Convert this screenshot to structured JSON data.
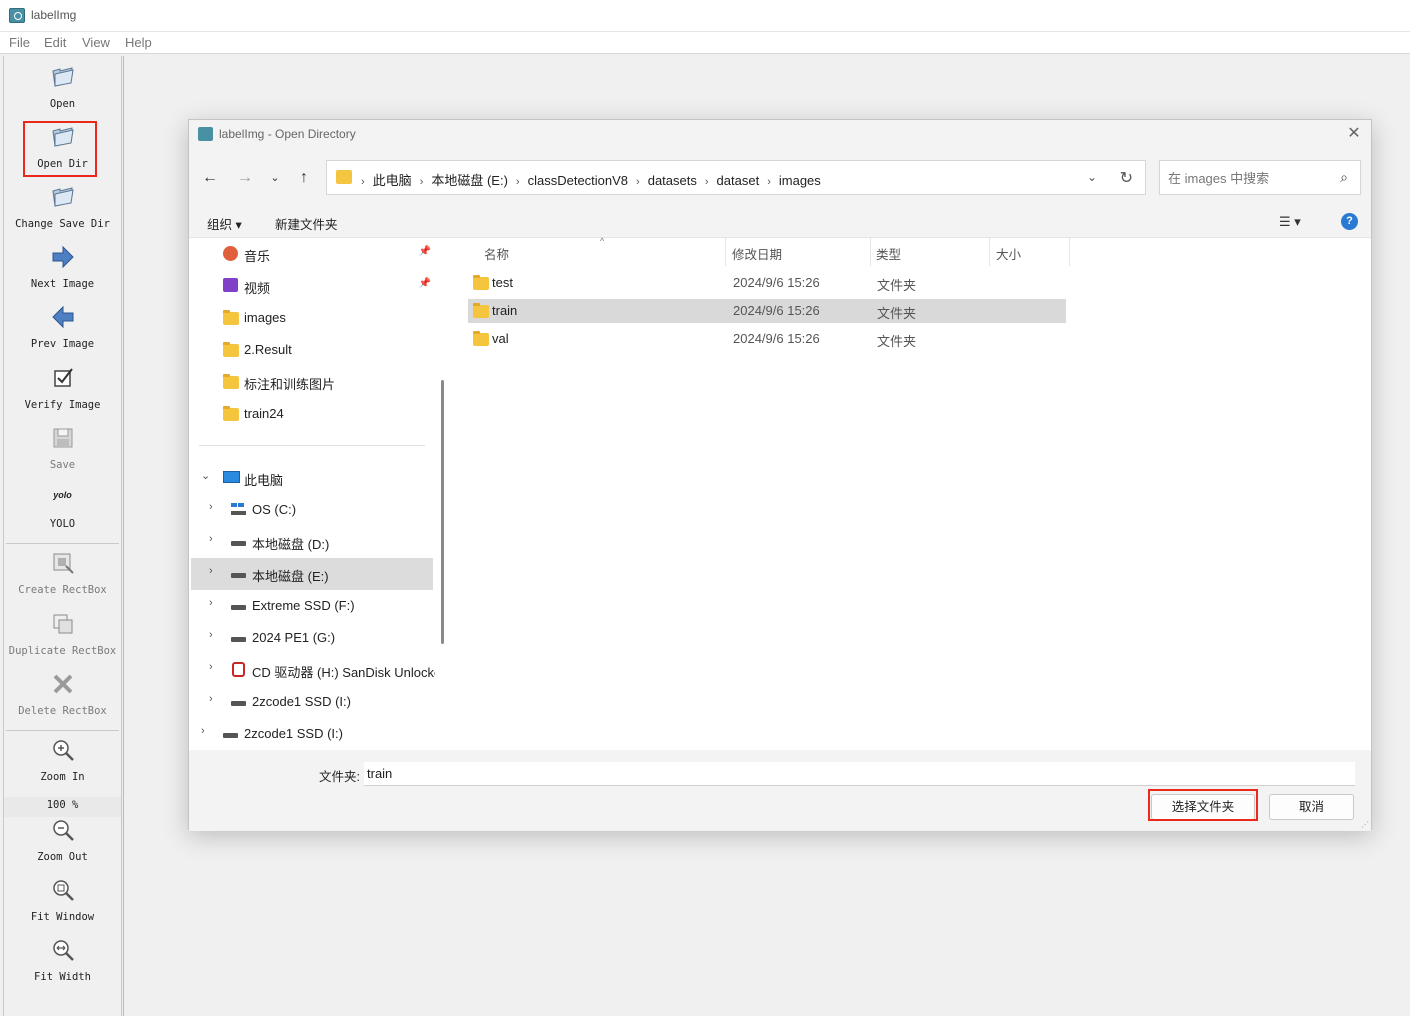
{
  "app": {
    "title": "labelImg",
    "menu": [
      "File",
      "Edit",
      "View",
      "Help"
    ]
  },
  "toolbar": {
    "open": "Open",
    "open_dir": "Open Dir",
    "change_save_dir": "Change Save Dir",
    "next_image": "Next Image",
    "prev_image": "Prev Image",
    "verify_image": "Verify Image",
    "save": "Save",
    "yolo_icon_text": "yolo",
    "yolo": "YOLO",
    "create_rectbox": "Create RectBox",
    "duplicate_rectbox": "Duplicate RectBox",
    "delete_rectbox": "Delete RectBox",
    "zoom_in": "Zoom In",
    "zoom_level": "100 %",
    "zoom_out": "Zoom Out",
    "fit_window": "Fit Window",
    "fit_width": "Fit Width"
  },
  "dialog": {
    "title": "labelImg - Open Directory",
    "close": "✕",
    "breadcrumbs": [
      "此电脑",
      "本地磁盘 (E:)",
      "classDetectionV8",
      "datasets",
      "dataset",
      "images"
    ],
    "search_placeholder": "在 images 中搜索",
    "commands": {
      "organize": "组织 ▾",
      "new_folder": "新建文件夹"
    },
    "nav_quick": [
      {
        "label": "音乐",
        "icon": "music-icon",
        "pinned": true
      },
      {
        "label": "视频",
        "icon": "video-icon",
        "pinned": true
      },
      {
        "label": "images",
        "icon": "folder-icon"
      },
      {
        "label": "2.Result",
        "icon": "folder-icon"
      },
      {
        "label": "标注和训练图片",
        "icon": "folder-icon"
      },
      {
        "label": "train24",
        "icon": "folder-icon"
      }
    ],
    "nav_pc": {
      "label": "此电脑",
      "drives": [
        {
          "label": "OS (C:)",
          "icon": "windows-drive-icon"
        },
        {
          "label": "本地磁盘 (D:)",
          "icon": "drive-icon"
        },
        {
          "label": "本地磁盘 (E:)",
          "icon": "drive-icon",
          "selected": true
        },
        {
          "label": "Extreme SSD (F:)",
          "icon": "drive-icon"
        },
        {
          "label": "2024 PE1 (G:)",
          "icon": "drive-icon"
        },
        {
          "label": "CD 驱动器 (H:) SanDisk Unlocke",
          "icon": "cd-drive-icon"
        },
        {
          "label": "2zcode1 SSD (I:)",
          "icon": "drive-icon"
        }
      ],
      "extra": {
        "label": "2zcode1 SSD (I:)",
        "icon": "drive-icon"
      }
    },
    "columns": [
      "名称",
      "修改日期",
      "类型",
      "大小"
    ],
    "files": [
      {
        "name": "test",
        "date": "2024/9/6 15:26",
        "type": "文件夹"
      },
      {
        "name": "train",
        "date": "2024/9/6 15:26",
        "type": "文件夹",
        "selected": true
      },
      {
        "name": "val",
        "date": "2024/9/6 15:26",
        "type": "文件夹"
      }
    ],
    "folder_label": "文件夹:",
    "folder_value": "train",
    "select_button": "选择文件夹",
    "cancel_button": "取消"
  }
}
